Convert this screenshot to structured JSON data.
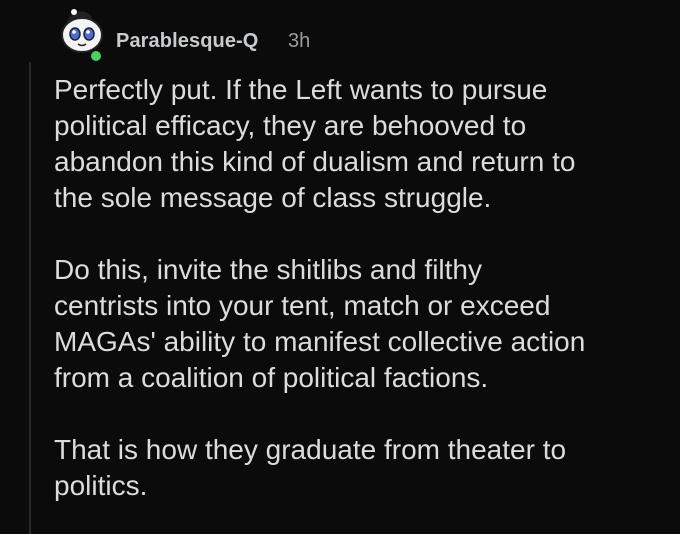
{
  "comment": {
    "author": "Parablesque-Q",
    "time": "3h",
    "avatar_icon": "snoo-avatar-icon",
    "online_status_color": "#46d160",
    "paragraphs": [
      [
        "Perfectly put. If the Left wants to pursue",
        "political efficacy, they are behooved to",
        "abandon this kind of dualism and return to",
        "the sole message of class struggle."
      ],
      [
        "Do this, invite the shitlibs and filthy",
        "centrists into your tent, match or exceed",
        "MAGAs' ability to manifest collective action",
        "from a coalition of political factions."
      ],
      [
        "That is how they graduate from theater to",
        "politics."
      ]
    ]
  }
}
